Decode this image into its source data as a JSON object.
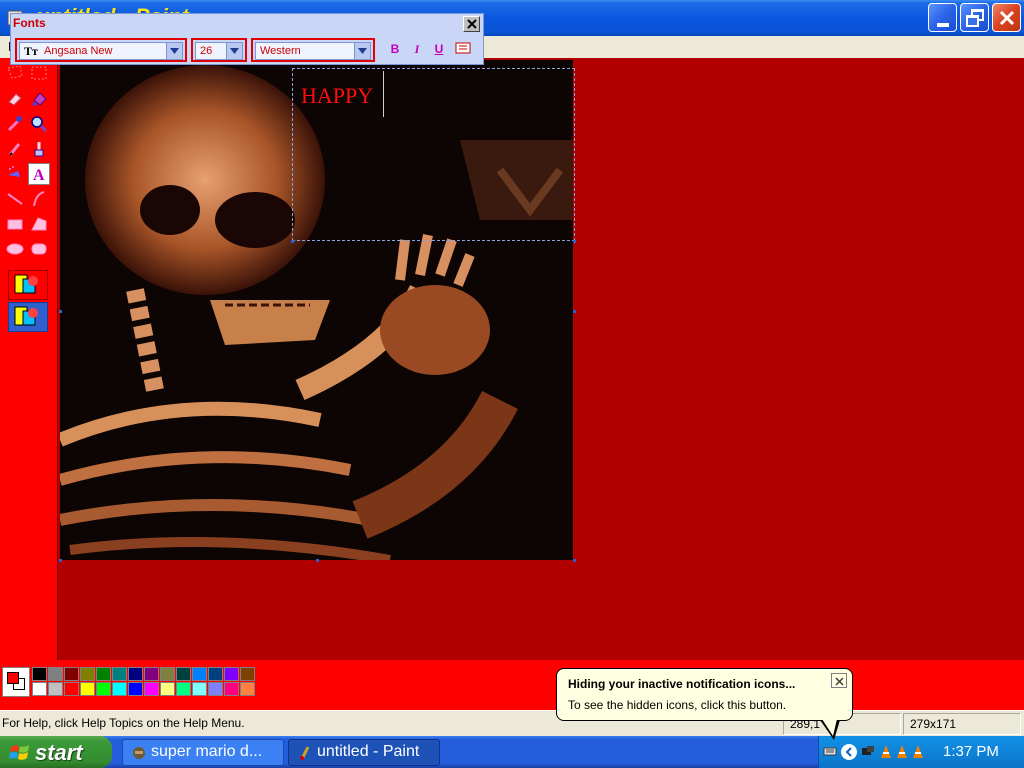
{
  "window": {
    "title": "untitled - Paint",
    "menu_first_letter": "F"
  },
  "fonts_toolbar": {
    "title": "Fonts",
    "font_name": "Angsana New",
    "font_size": "26",
    "script": "Western",
    "bold_label": "B",
    "italic_label": "I",
    "underline_label": "U"
  },
  "canvas": {
    "typed_text": "HAPPY"
  },
  "palette": {
    "colors_row1": [
      "#000000",
      "#808080",
      "#800000",
      "#808000",
      "#008000",
      "#008080",
      "#000080",
      "#800080",
      "#808040",
      "#004040",
      "#0080ff",
      "#004080",
      "#8000ff",
      "#804000"
    ],
    "colors_row2": [
      "#ffffff",
      "#c0c0c0",
      "#ff0000",
      "#ffff00",
      "#00ff00",
      "#00ffff",
      "#0000ff",
      "#ff00ff",
      "#ffff80",
      "#00ff80",
      "#80ffff",
      "#8080ff",
      "#ff0080",
      "#ff8040"
    ],
    "foreground": "#ff0000",
    "background": "#ffffff"
  },
  "status": {
    "help_text": "For Help, click Help Topics on the Help Menu.",
    "coordinates": "289,1",
    "selection_size": "279x171"
  },
  "balloon": {
    "title": "Hiding your inactive notification icons...",
    "text": "To see the hidden icons, click this button."
  },
  "taskbar": {
    "start_label": "start",
    "tasks": [
      {
        "label": "super mario d...",
        "icon": "game-icon"
      },
      {
        "label": "untitled - Paint",
        "icon": "paint-icon"
      }
    ],
    "clock": "1:37 PM"
  }
}
